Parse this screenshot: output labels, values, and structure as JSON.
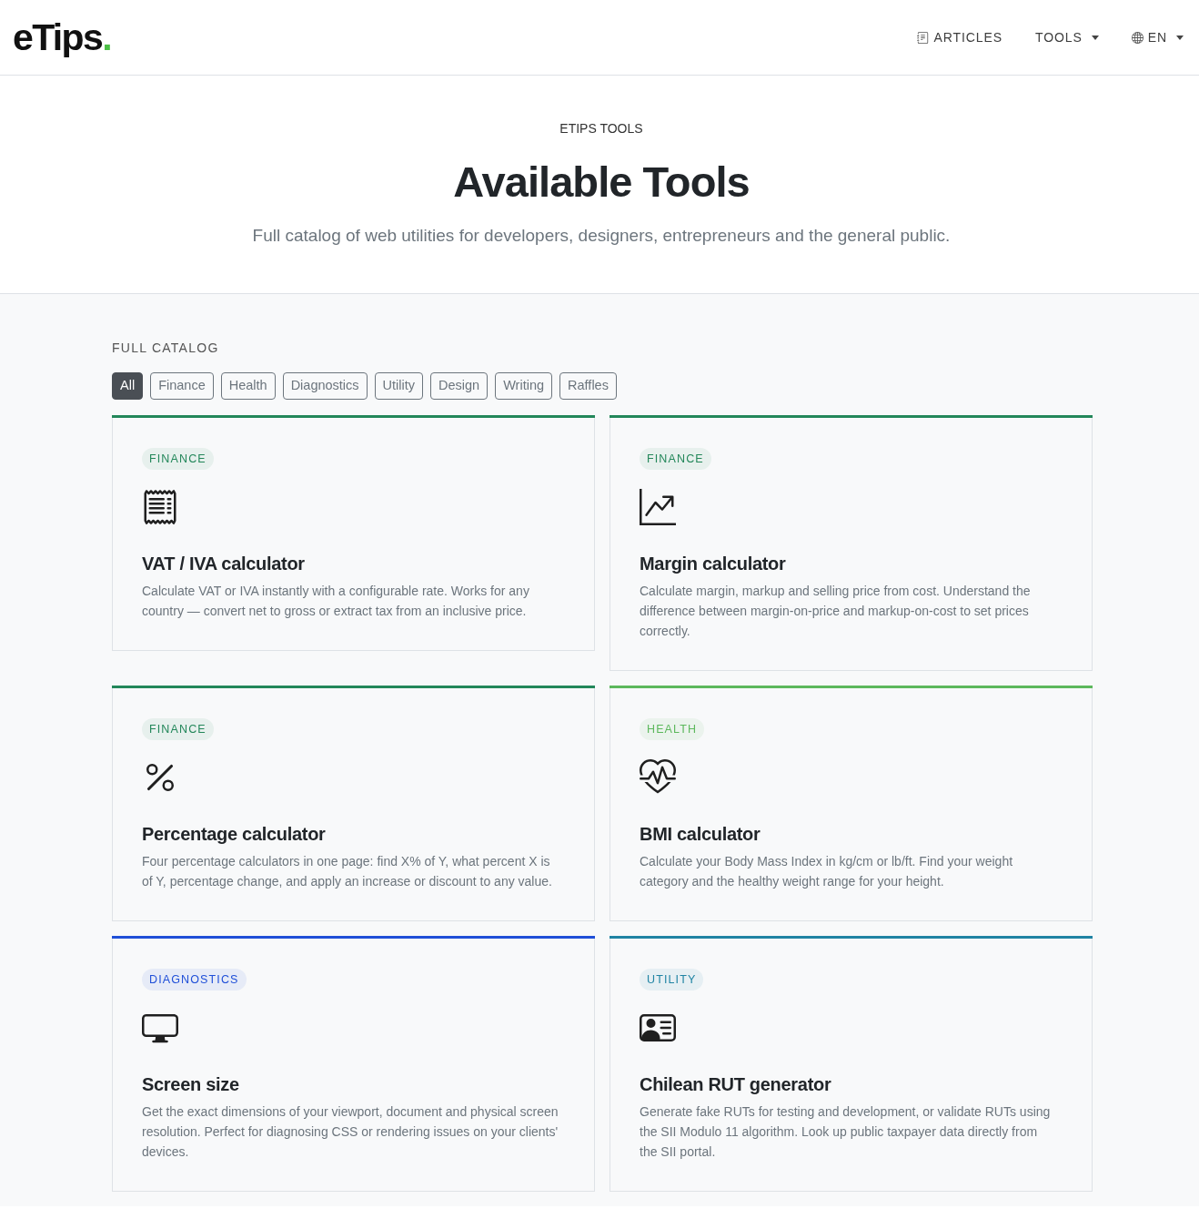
{
  "header": {
    "logo": {
      "text": "eTips",
      "dot": "."
    },
    "nav": [
      {
        "label": "ARTICLES",
        "kind": "link"
      },
      {
        "label": "TOOLS",
        "kind": "dropdown"
      },
      {
        "label": "EN",
        "kind": "language"
      }
    ]
  },
  "hero": {
    "eyebrow": "ETIPS TOOLS",
    "title": "Available Tools",
    "subtitle": "Full catalog of web utilities for developers, designers, entrepreneurs and the general public."
  },
  "catalog": {
    "heading": "FULL CATALOG",
    "filters": [
      {
        "label": "All",
        "selected": true
      },
      {
        "label": "Finance",
        "selected": false
      },
      {
        "label": "Health",
        "selected": false
      },
      {
        "label": "Diagnostics",
        "selected": false
      },
      {
        "label": "Utility",
        "selected": false
      },
      {
        "label": "Design",
        "selected": false
      },
      {
        "label": "Writing",
        "selected": false
      },
      {
        "label": "Raffles",
        "selected": false
      }
    ],
    "cards": [
      {
        "category": "FINANCE",
        "color": "#23875a",
        "title": "VAT / IVA calculator",
        "description": "Calculate VAT or IVA instantly with a configurable rate. Works for any country — convert net to gross or extract tax from an inclusive price."
      },
      {
        "category": "FINANCE",
        "color": "#23875a",
        "title": "Margin calculator",
        "description": "Calculate margin, markup and selling price from cost. Understand the difference between margin-on-price and markup-on-cost to set prices correctly."
      },
      {
        "category": "FINANCE",
        "color": "#23875a",
        "title": "Percentage calculator",
        "description": "Four percentage calculators in one page: find X% of Y, what percent X is of Y, percentage change, and apply an increase or discount to any value."
      },
      {
        "category": "HEALTH",
        "color": "#5cb85c",
        "title": "BMI calculator",
        "description": "Calculate your Body Mass Index in kg/cm or lb/ft. Find your weight category and the healthy weight range for your height."
      },
      {
        "category": "DIAGNOSTICS",
        "color": "#1f4fd8",
        "title": "Screen size",
        "description": "Get the exact dimensions of your viewport, document and physical screen resolution. Perfect for diagnosing CSS or rendering issues on your clients' devices."
      },
      {
        "category": "UTILITY",
        "color": "#1f83a3",
        "title": "Chilean RUT generator",
        "description": "Generate fake RUTs for testing and development, or validate RUTs using the SII Modulo 11 algorithm. Look up public taxpayer data directly from the SII portal."
      }
    ]
  }
}
